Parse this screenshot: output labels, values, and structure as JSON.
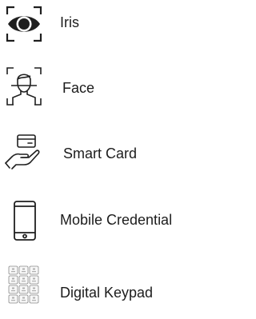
{
  "methods": [
    {
      "label": "Iris",
      "icon": "eye-scan-icon"
    },
    {
      "label": "Face",
      "icon": "face-scan-icon"
    },
    {
      "label": "Smart Card",
      "icon": "smart-card-hand-icon"
    },
    {
      "label": "Mobile Credential",
      "icon": "mobile-phone-icon"
    },
    {
      "label": "Digital Keypad",
      "icon": "keypad-icon"
    }
  ],
  "colors": {
    "icon": "#1f1f1f",
    "text": "#1c1c1c",
    "background": "#ffffff"
  }
}
